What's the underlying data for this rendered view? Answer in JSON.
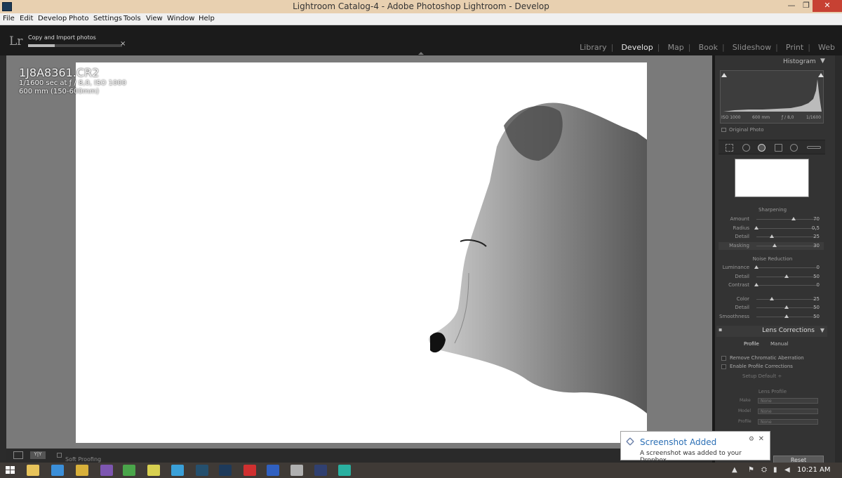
{
  "window": {
    "title": "Lightroom Catalog-4 - Adobe Photoshop Lightroom - Develop",
    "minimize": "—",
    "maximize": "❐",
    "close": "✕"
  },
  "menu": [
    "File",
    "Edit",
    "Develop",
    "Photo",
    "Settings",
    "Tools",
    "View",
    "Window",
    "Help"
  ],
  "header": {
    "logo": "Lr",
    "import_task": "Copy and Import photos",
    "import_progress_pct": 28,
    "cancel_glyph": "×",
    "modules": [
      {
        "label": "Library",
        "active": false
      },
      {
        "label": "Develop",
        "active": true
      },
      {
        "label": "Map",
        "active": false
      },
      {
        "label": "Book",
        "active": false
      },
      {
        "label": "Slideshow",
        "active": false
      },
      {
        "label": "Print",
        "active": false
      },
      {
        "label": "Web",
        "active": false
      }
    ]
  },
  "photo_info": {
    "filename": "1J8A8361.CR2",
    "exposure": "1/1600 sec at ƒ / 8,0, ISO 1000",
    "lens": "600 mm (150-600mm)"
  },
  "right_panel": {
    "histogram_title": "Histogram",
    "histogram_info": {
      "iso": "ISO 1000",
      "focal": "600 mm",
      "aperture": "ƒ / 8,0",
      "shutter": "1/1600"
    },
    "original_photo": "Original Photo",
    "sharpening": {
      "title": "Sharpening",
      "rows": [
        {
          "label": "Amount",
          "value": "70",
          "pos": 0.62
        },
        {
          "label": "Radius",
          "value": "0,5",
          "pos": 0.0
        },
        {
          "label": "Detail",
          "value": "25",
          "pos": 0.25
        },
        {
          "label": "Masking",
          "value": "30",
          "pos": 0.3
        }
      ]
    },
    "noise_reduction": {
      "title": "Noise Reduction",
      "rows": [
        {
          "label": "Luminance",
          "value": "0",
          "pos": 0.0
        },
        {
          "label": "Detail",
          "value": "50",
          "pos": 0.5
        },
        {
          "label": "Contrast",
          "value": "0",
          "pos": 0.0
        },
        {
          "label": "Color",
          "value": "25",
          "pos": 0.25
        },
        {
          "label": "Detail",
          "value": "50",
          "pos": 0.5
        },
        {
          "label": "Smoothness",
          "value": "50",
          "pos": 0.5
        }
      ]
    },
    "lens_corrections": {
      "title": "Lens Corrections",
      "tabs": [
        "Profile",
        "Manual"
      ],
      "checkboxes": [
        "Remove Chromatic Aberration",
        "Enable Profile Corrections"
      ],
      "setup_label": "Setup",
      "setup_value": "Default ÷",
      "lens_profile_title": "Lens Profile",
      "lens_profile_rows": [
        {
          "label": "Make",
          "value": "None"
        },
        {
          "label": "Model",
          "value": "None"
        },
        {
          "label": "Profile",
          "value": "None"
        }
      ]
    },
    "reset_label": "Reset"
  },
  "bottom_bar": {
    "soft_proofing": "Soft Proofing"
  },
  "toast": {
    "title": "Screenshot Added",
    "message": "A screenshot was added to your Dropbox.",
    "close": "✕",
    "action": "⚙"
  },
  "taskbar": {
    "clock": "10:21 AM",
    "apps": [
      {
        "name": "file-explorer",
        "color": "#e7c35a"
      },
      {
        "name": "internet-explorer",
        "color": "#3b8fd9"
      },
      {
        "name": "chrome",
        "color": "#d8b03a"
      },
      {
        "name": "visual-studio",
        "color": "#7d56b0"
      },
      {
        "name": "green-app",
        "color": "#4aa54a"
      },
      {
        "name": "yellow-app",
        "color": "#d8d050"
      },
      {
        "name": "cloud-app",
        "color": "#3aa0d8"
      },
      {
        "name": "lightroom",
        "color": "#25506e"
      },
      {
        "name": "photoshop",
        "color": "#1e3a5a"
      },
      {
        "name": "red-app",
        "color": "#d03030"
      },
      {
        "name": "blue-app",
        "color": "#3060c0"
      },
      {
        "name": "gray-app",
        "color": "#b0b0b0"
      },
      {
        "name": "dark-app",
        "color": "#304070"
      },
      {
        "name": "b-app",
        "color": "#2ab0a0"
      }
    ]
  }
}
